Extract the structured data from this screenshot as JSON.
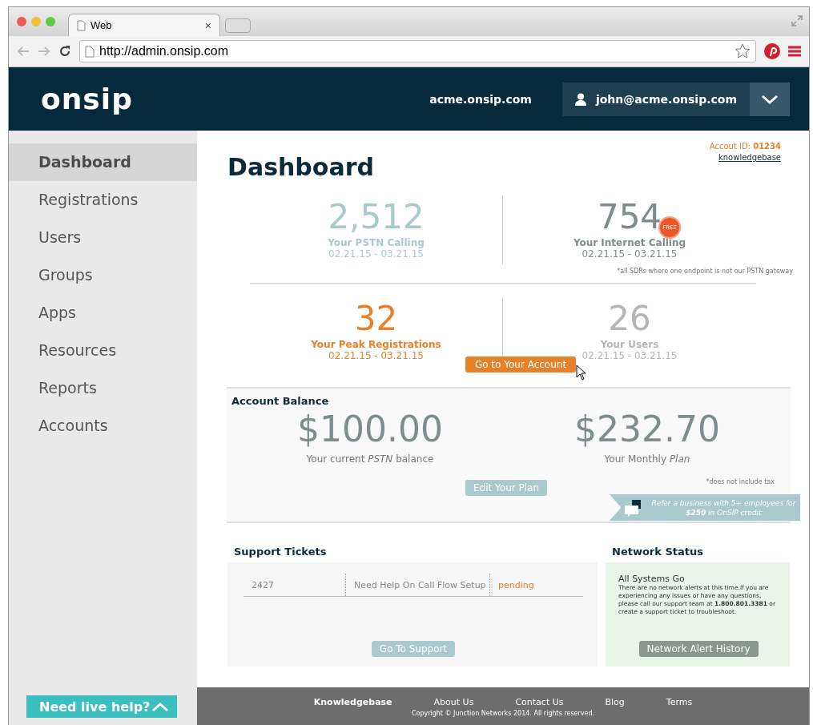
{
  "browser": {
    "tab_title": "Web",
    "tab_close": "×",
    "url": "http://admin.onsip.com"
  },
  "header": {
    "logo": "onsip",
    "domain": "acme.onsip.com",
    "user": "john@acme.onsip.com"
  },
  "sidebar": {
    "items": [
      {
        "label": "Dashboard",
        "selected": true
      },
      {
        "label": "Registrations",
        "selected": false
      },
      {
        "label": "Users",
        "selected": false
      },
      {
        "label": "Groups",
        "selected": false
      },
      {
        "label": "Apps",
        "selected": false
      },
      {
        "label": "Resources",
        "selected": false
      },
      {
        "label": "Reports",
        "selected": false
      },
      {
        "label": "Accounts",
        "selected": false
      }
    ],
    "live_help": "Need live help?"
  },
  "page": {
    "title": "Dashboard",
    "account_id_label": "Accout ID:",
    "account_id": "01234",
    "knowledgebase": "knowledgebase"
  },
  "stats": [
    {
      "value": "2,512",
      "label": "Your PSTN Calling",
      "dates": "02.21.15 - 03.21.15",
      "color": "#a9c9cc"
    },
    {
      "value": "754",
      "label": "Your Internet Calling",
      "dates": "02.21.15 - 03.21.15",
      "color": "#7f8c8d",
      "badge": "FREE"
    },
    {
      "value": "32",
      "label": "Your Peak Registrations",
      "dates": "02.21.15 - 03.21.15",
      "color": "#e8802a"
    },
    {
      "value": "26",
      "label": "Your Users",
      "dates": "02.21.15 - 03.21.15",
      "color": "#b5b5b5"
    }
  ],
  "stats_footnote": "*all SDRs where one endpoint is not our PSTN gateway",
  "account_button": "Go to Your Account",
  "balance": {
    "title": "Account Balance",
    "amounts": [
      {
        "value": "$100.00",
        "label": "Your current *PSTN* balance"
      },
      {
        "value": "$232.70",
        "label": "Your Monthly *Plan*"
      }
    ],
    "footnote": "*does not include tax",
    "button": "Edit Your Plan",
    "referral": "Refer a business with 5+ employees for **$250** in OnSIP credit"
  },
  "support": {
    "title": "Support Tickets",
    "tickets": [
      {
        "id": "2427",
        "subject": "Need Help On Call Flow Setup",
        "status": "pending"
      }
    ],
    "button": "Go To Support"
  },
  "network": {
    "title": "Network Status",
    "headline": "All Systems Go",
    "text": "There are no network alerts at this time.If you are experiencing any issues or have any questions, please call our support team at **1.800.801.3381** or create a support ticket to troubleshoot.",
    "button": "Network Alert History"
  },
  "footer": {
    "links": [
      {
        "label": "Knowledgebase",
        "selected": true
      },
      {
        "label": "About Us",
        "selected": false
      },
      {
        "label": "Contact Us",
        "selected": false
      },
      {
        "label": "Blog",
        "selected": false
      },
      {
        "label": "Terms",
        "selected": false
      }
    ],
    "copyright": "Copyright © Junction Networks 2014. All rights reserved."
  }
}
